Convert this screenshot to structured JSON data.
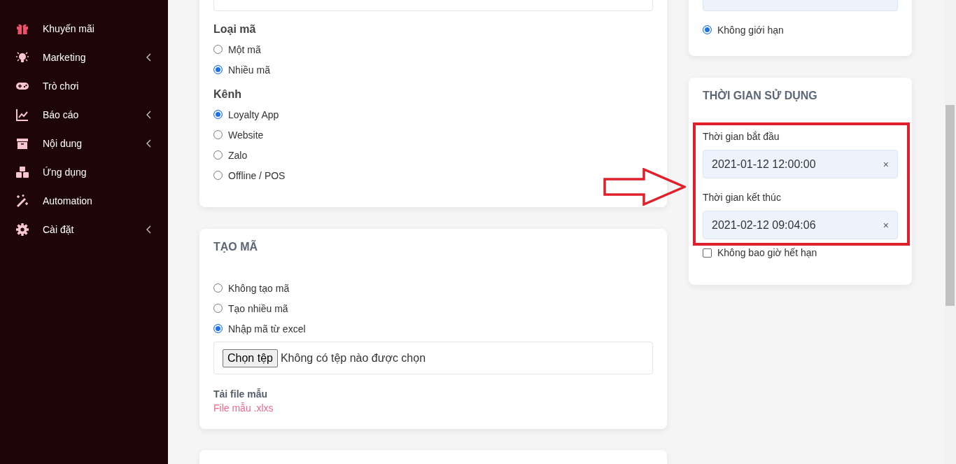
{
  "sidebar": {
    "items": [
      {
        "label": "Khuyến mãi",
        "kind": "gift",
        "submenu": false,
        "selected": true
      },
      {
        "label": "Marketing",
        "kind": "bulb",
        "submenu": true,
        "selected": false
      },
      {
        "label": "Trò chơi",
        "kind": "gamepad",
        "submenu": false,
        "selected": false
      },
      {
        "label": "Báo cáo",
        "kind": "chart",
        "submenu": true,
        "selected": false
      },
      {
        "label": "Nội dung",
        "kind": "archive",
        "submenu": true,
        "selected": false
      },
      {
        "label": "Ứng dụng",
        "kind": "cubes",
        "submenu": false,
        "selected": false
      },
      {
        "label": "Automation",
        "kind": "wand",
        "submenu": false,
        "selected": false
      },
      {
        "label": "Cài đặt",
        "kind": "gear",
        "submenu": true,
        "selected": false
      }
    ]
  },
  "promo_card": {
    "groups": [
      {
        "label": "Loại mã",
        "options": [
          {
            "label": "Một mã",
            "selected": false
          },
          {
            "label": "Nhiều mã",
            "selected": true
          }
        ]
      },
      {
        "label": "Kênh",
        "options": [
          {
            "label": "Loyalty App",
            "selected": true
          },
          {
            "label": "Website",
            "selected": false
          },
          {
            "label": "Zalo",
            "selected": false
          },
          {
            "label": "Offline / POS",
            "selected": false
          }
        ]
      }
    ]
  },
  "code_card": {
    "title": "TẠO MÃ",
    "options": [
      {
        "label": "Không tạo mã",
        "selected": false
      },
      {
        "label": "Tạo nhiều mã",
        "selected": false
      },
      {
        "label": "Nhập mã từ excel",
        "selected": true
      }
    ],
    "file_button": "Chọn tệp",
    "file_status": "Không có tệp nào được chọn",
    "template_label": "Tải file mẫu",
    "template_link": "File mẫu .xlxs"
  },
  "limit_card": {
    "options": [
      {
        "label": "Không giới hạn",
        "selected": true
      }
    ]
  },
  "usage_card": {
    "title": "THỜI GIAN SỬ DỤNG",
    "fields": [
      {
        "label": "Thời gian bắt đầu",
        "value": "2021-01-12 12:00:00",
        "clear": "×"
      },
      {
        "label": "Thời gian kết thúc",
        "value": "2021-02-12 09:04:06",
        "clear": "×"
      }
    ],
    "no_expiry": {
      "label": "Không bao giờ hết hạn",
      "checked": false
    }
  }
}
